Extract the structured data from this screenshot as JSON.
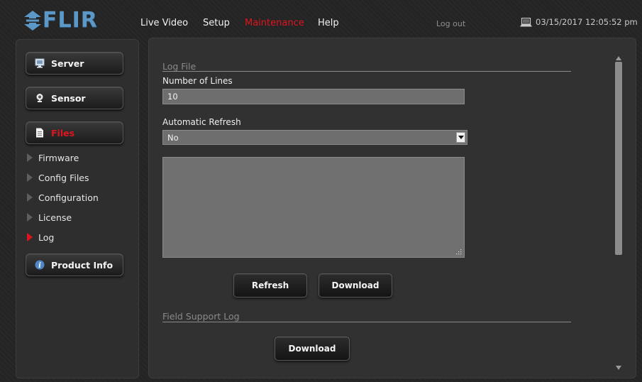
{
  "brand": {
    "logo_text": "FLIR"
  },
  "nav": {
    "items": [
      {
        "label": "Live Video"
      },
      {
        "label": "Setup"
      },
      {
        "label": "Maintenance"
      },
      {
        "label": "Help"
      }
    ],
    "active": "Maintenance",
    "logout_label": "Log out",
    "datetime": "03/15/2017 12:05:52 pm",
    "datetime_icon": "laptop-icon"
  },
  "sidebar": {
    "buttons": [
      {
        "label": "Server",
        "icon": "monitor-icon"
      },
      {
        "label": "Sensor",
        "icon": "webcam-icon"
      },
      {
        "label": "Files",
        "icon": "document-icon"
      },
      {
        "label": "Product Info",
        "icon": "info-icon"
      }
    ],
    "active_button": "Files",
    "sub_items": [
      {
        "label": "Firmware"
      },
      {
        "label": "Config Files"
      },
      {
        "label": "Configuration"
      },
      {
        "label": "License"
      },
      {
        "label": "Log"
      }
    ],
    "active_sub_item": "Log"
  },
  "log_file": {
    "section_title": "Log File",
    "lines_label": "Number of Lines",
    "lines_value": "10",
    "refresh_label": "Automatic Refresh",
    "refresh_value": "No",
    "log_text": "",
    "refresh_button": "Refresh",
    "download_button": "Download"
  },
  "field_support": {
    "section_title": "Field Support Log",
    "download_button": "Download"
  },
  "colors": {
    "accent_red": "#e0141e",
    "brand_blue": "#5b97c7",
    "background": "#242424",
    "panel": "#313131"
  }
}
